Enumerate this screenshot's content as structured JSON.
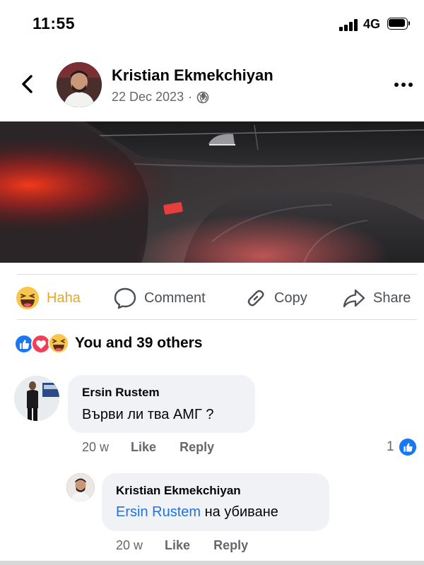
{
  "status_bar": {
    "time": "11:55",
    "network": "4G"
  },
  "post": {
    "author": "Kristian Ekmekchiyan",
    "date": "22 Dec 2023",
    "separator": "·",
    "privacy_icon": "globe-icon"
  },
  "actions": [
    {
      "label": "Haha",
      "icon": "haha-emoji-icon",
      "active": true
    },
    {
      "label": "Comment",
      "icon": "comment-icon"
    },
    {
      "label": "Copy",
      "icon": "link-icon"
    },
    {
      "label": "Share",
      "icon": "share-arrow-icon"
    }
  ],
  "reactions": {
    "summary": "You and 39 others",
    "icons": [
      "like-icon",
      "love-icon",
      "haha-icon"
    ]
  },
  "comments": [
    {
      "author": "Ersin Rustem",
      "text": "Върви ли тва АМГ ?",
      "time": "20 w",
      "like_label": "Like",
      "reply_label": "Reply",
      "like_count": "1"
    },
    {
      "author": "Kristian Ekmekchiyan",
      "mention": "Ersin Rustem",
      "text": "на убиване",
      "time": "20 w",
      "like_label": "Like",
      "reply_label": "Reply"
    }
  ],
  "colors": {
    "brand_blue": "#1b74e4",
    "haha_yellow": "#e5a82a",
    "love_red": "#f33e58",
    "muted": "#65676b",
    "bubble": "#f0f2f5"
  }
}
